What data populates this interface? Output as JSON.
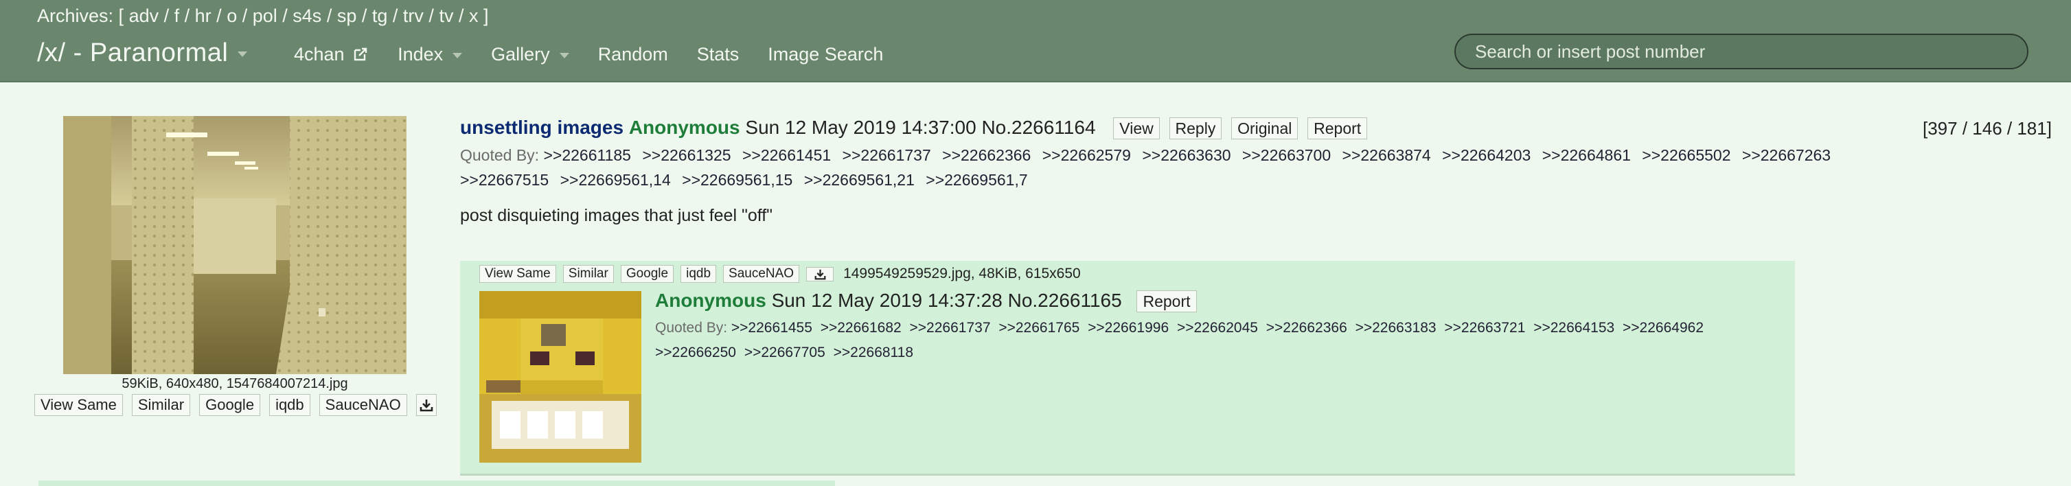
{
  "topbar": {
    "archives_prefix": "Archives: [",
    "archives": [
      "adv",
      "f",
      "hr",
      "o",
      "pol",
      "s4s",
      "sp",
      "tg",
      "trv",
      "tv",
      "x"
    ],
    "archives_suffix": "]",
    "board_title": "/x/ - Paranormal",
    "nav": {
      "fourchan": "4chan",
      "index": "Index",
      "gallery": "Gallery",
      "random": "Random",
      "stats": "Stats",
      "image_search": "Image Search"
    },
    "search_placeholder": "Search or insert post number"
  },
  "op": {
    "subject": "unsettling images",
    "name": "Anonymous",
    "date": "Sun 12 May 2019 14:37:00",
    "number": "No.22661164",
    "buttons": {
      "view": "View",
      "reply": "Reply",
      "original": "Original",
      "report": "Report"
    },
    "stats": "[397 / 146 / 181]",
    "quoted_by_label": "Quoted By:",
    "quoted_by": [
      ">>22661185",
      ">>22661325",
      ">>22661451",
      ">>22661737",
      ">>22662366",
      ">>22662579",
      ">>22663630",
      ">>22663700",
      ">>22663874",
      ">>22664203",
      ">>22664861",
      ">>22665502",
      ">>22667263",
      ">>22667515",
      ">>22669561,14",
      ">>22669561,15",
      ">>22669561,21",
      ">>22669561,7"
    ],
    "body": "post disquieting images that just feel \"off\"",
    "file_info": "59KiB, 640x480, 1547684007214.jpg",
    "image_buttons": {
      "view_same": "View Same",
      "similar": "Similar",
      "google": "Google",
      "iqdb": "iqdb",
      "saucenao": "SauceNAO"
    }
  },
  "reply": {
    "image_buttons": {
      "view_same": "View Same",
      "similar": "Similar",
      "google": "Google",
      "iqdb": "iqdb",
      "saucenao": "SauceNAO"
    },
    "file_info": "1499549259529.jpg, 48KiB, 615x650",
    "name": "Anonymous",
    "date": "Sun 12 May 2019 14:37:28",
    "number": "No.22661165",
    "report": "Report",
    "quoted_by_label": "Quoted By:",
    "quoted_by": [
      ">>22661455",
      ">>22661682",
      ">>22661737",
      ">>22661765",
      ">>22661996",
      ">>22662045",
      ">>22662366",
      ">>22663183",
      ">>22663721",
      ">>22664153",
      ">>22664962",
      ">>22666250",
      ">>22667705",
      ">>22668118"
    ]
  },
  "colors": {
    "topbar": "#6a876e",
    "page_bg": "#eef8ee",
    "reply_bg": "#d3f0d9",
    "subject": "#0b2a72",
    "name": "#1f7d3a"
  },
  "icons": [
    "external-link-icon",
    "caret-down-icon",
    "download-icon"
  ]
}
